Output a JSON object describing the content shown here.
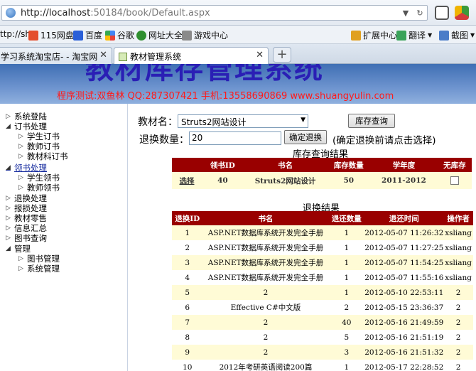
{
  "browser": {
    "url_host": "http://localhost",
    "url_rest": ":50184/book/Default.aspx",
    "bookmarks": [
      {
        "label": "ttp://sh"
      },
      {
        "label": "115网盘"
      },
      {
        "label": "百度"
      },
      {
        "label": "谷歌"
      },
      {
        "label": "网址大全"
      },
      {
        "label": "游戏中心"
      }
    ],
    "right_tools": [
      {
        "label": "扩展中心"
      },
      {
        "label": "翻译"
      },
      {
        "label": "截图"
      }
    ],
    "tabs": [
      {
        "label": "学习系统淘宝店- - 淘宝网"
      },
      {
        "label": "教材管理系统"
      }
    ]
  },
  "header": {
    "title": "教材库存管理系统",
    "subtitle": "程序测试:双鱼林 QQ:287307421 手机:13558690869 www.shuangyulin.com"
  },
  "sidebar": {
    "items": [
      {
        "label": "系统登陆",
        "expanded": false,
        "level": 0
      },
      {
        "label": "订书处理",
        "expanded": true,
        "level": 0
      },
      {
        "label": "学生订书",
        "expanded": false,
        "level": 1
      },
      {
        "label": "教师订书",
        "expanded": false,
        "level": 1
      },
      {
        "label": "教材科订书",
        "expanded": false,
        "level": 1
      },
      {
        "label": "领书处理",
        "expanded": true,
        "level": 0
      },
      {
        "label": "学生领书",
        "expanded": false,
        "level": 1
      },
      {
        "label": "教师领书",
        "expanded": false,
        "level": 1
      },
      {
        "label": "退换处理",
        "expanded": false,
        "level": 0
      },
      {
        "label": "报损处理",
        "expanded": false,
        "level": 0
      },
      {
        "label": "教材零售",
        "expanded": false,
        "level": 0
      },
      {
        "label": "信息汇总",
        "expanded": false,
        "level": 0
      },
      {
        "label": "图书查询",
        "expanded": false,
        "level": 0
      },
      {
        "label": "管理",
        "expanded": true,
        "level": 0
      },
      {
        "label": "图书管理",
        "expanded": false,
        "level": 1
      },
      {
        "label": "系统管理",
        "expanded": false,
        "level": 1
      }
    ]
  },
  "form": {
    "book_label": "教材名：",
    "book_selected": "Struts2网站设计",
    "query_button": "库存查询",
    "qty_label": "退换数量：",
    "qty_value": "20",
    "confirm_button": "确定退换",
    "confirm_hint": "(确定退换前请点击选择)"
  },
  "stock": {
    "caption": "库存查询结果",
    "headers": [
      "",
      "领书ID",
      "书名",
      "库存数量",
      "学年度",
      "无库存"
    ],
    "rows": [
      {
        "select": "选择",
        "id": "40",
        "name": "Struts2网站设计",
        "qty": "50",
        "year": "2011-2012",
        "no_stock": false
      }
    ]
  },
  "returns": {
    "caption": "退换结果",
    "headers": [
      "退换ID",
      "书名",
      "退还数量",
      "退还时间",
      "操作者"
    ],
    "rows": [
      [
        "1",
        "ASP.NET数据库系统开发完全手册",
        "1",
        "2012-05-07 11:26:32",
        "xsliang"
      ],
      [
        "2",
        "ASP.NET数据库系统开发完全手册",
        "1",
        "2012-05-07 11:27:25",
        "xsliang"
      ],
      [
        "3",
        "ASP.NET数据库系统开发完全手册",
        "1",
        "2012-05-07 11:54:25",
        "xsliang"
      ],
      [
        "4",
        "ASP.NET数据库系统开发完全手册",
        "1",
        "2012-05-07 11:55:16",
        "xsliang"
      ],
      [
        "5",
        "2",
        "1",
        "2012-05-10 22:53:11",
        "2"
      ],
      [
        "6",
        "Effective C#中文版",
        "2",
        "2012-05-15 23:36:37",
        "2"
      ],
      [
        "7",
        "2",
        "40",
        "2012-05-16 21:49:59",
        "2"
      ],
      [
        "8",
        "2",
        "5",
        "2012-05-16 21:51:19",
        "2"
      ],
      [
        "9",
        "2",
        "3",
        "2012-05-16 21:51:32",
        "2"
      ],
      [
        "10",
        "2012年考研英语阅读200篇",
        "1",
        "2012-05-17 22:28:52",
        "2"
      ]
    ]
  }
}
